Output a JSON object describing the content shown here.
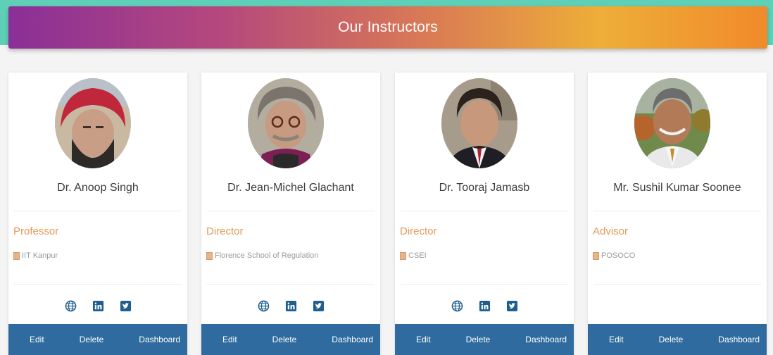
{
  "header": {
    "title": "Our Instructors"
  },
  "actions": {
    "edit": "Edit",
    "delete": "Delete",
    "dashboard": "Dashboard"
  },
  "instructors": [
    {
      "name": "Dr. Anoop Singh",
      "role": "Professor",
      "org": "IIT Kanpur",
      "socials": [
        "globe-icon",
        "linkedin-icon",
        "twitter-icon"
      ]
    },
    {
      "name": "Dr. Jean-Michel Glachant",
      "role": "Director",
      "org": "Florence School of Regulation",
      "socials": [
        "globe-icon",
        "linkedin-icon",
        "twitter-icon"
      ]
    },
    {
      "name": "Dr. Tooraj Jamasb",
      "role": "Director",
      "org": "CSEI",
      "socials": [
        "globe-icon",
        "linkedin-icon",
        "twitter-icon"
      ]
    },
    {
      "name": "Mr. Sushil Kumar Soonee",
      "role": "Advisor",
      "org": "POSOCO",
      "socials": []
    }
  ],
  "colors": {
    "banner_start": "#8a2f97",
    "banner_end": "#f08a2a",
    "action_bar": "#2f6b9e",
    "role_text": "#e39a58",
    "social_icon": "#1f5f8f"
  }
}
